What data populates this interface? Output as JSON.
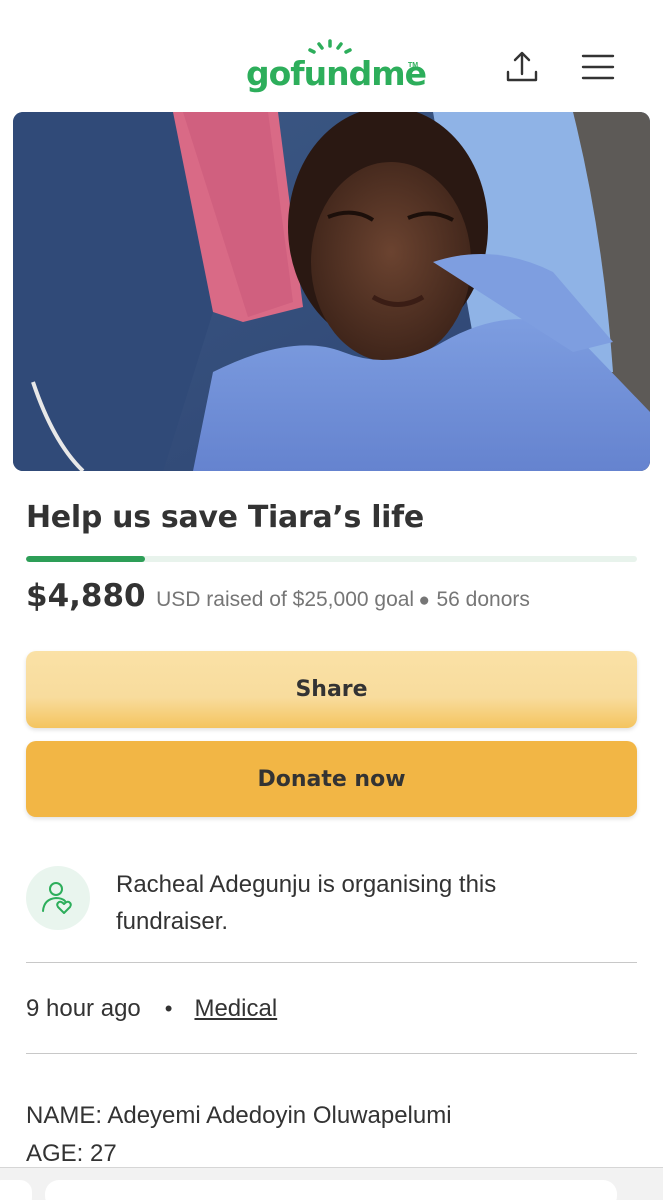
{
  "header": {
    "logo_text": "gofundme",
    "logo_tm": "TM",
    "share_icon": "upload-share-icon",
    "menu_icon": "hamburger-menu-icon"
  },
  "hero": {
    "image": "photo of a young woman in a blue hospital gown lying on a pillow with a pink towel"
  },
  "campaign": {
    "title": "Help us save Tiara’s life",
    "progress_fraction": 0.1952,
    "amount": "$4,880",
    "raised_text": "USD raised of $25,000 goal",
    "dot": "●",
    "donors": "56 donors"
  },
  "buttons": {
    "share_label": "Share",
    "donate_label": "Donate now"
  },
  "organiser": {
    "icon": "person-heart-icon",
    "text": "Racheal Adegunju is organising this fundraiser."
  },
  "meta": {
    "time": "9 hour ago",
    "separator": "•",
    "category": "Medical"
  },
  "story": {
    "name_line": "NAME: Adeyemi Adedoyin Oluwapelumi",
    "age_line": "AGE: 27"
  },
  "colors": {
    "brand_green": "#2dae5b",
    "progress_green": "#2d9e57",
    "share_button": "#f8dc9d",
    "donate_button": "#f2b645"
  }
}
